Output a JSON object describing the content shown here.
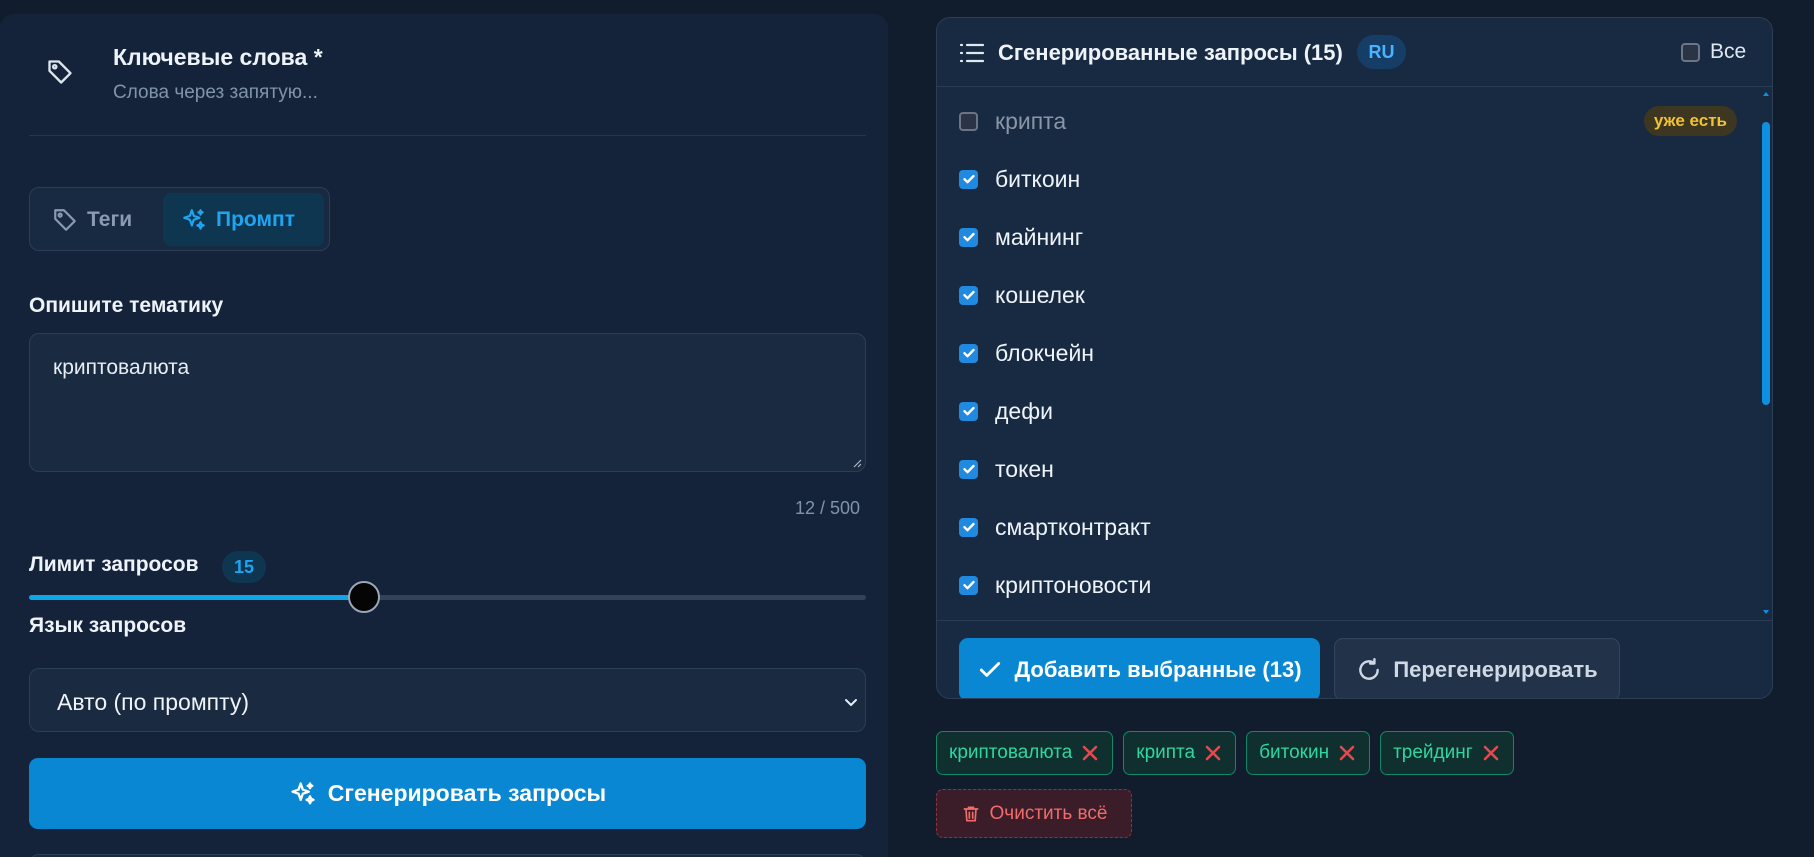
{
  "keywords": {
    "title": "Ключевые слова *",
    "subtitle": "Слова через запятую..."
  },
  "modes": {
    "tags_label": "Теги",
    "prompt_label": "Промпт",
    "active": "prompt"
  },
  "topic": {
    "label": "Опишите тематику",
    "value": "криптовалюта",
    "counter": "12 / 500"
  },
  "limit": {
    "label": "Лимит запросов",
    "value": 15,
    "value_text": "15",
    "level_fraction": 0.4
  },
  "language": {
    "label": "Язык запросов",
    "selected": "Авто (по промпту)"
  },
  "generate_button": "Сгенерировать запросы",
  "results": {
    "title": "Сгенерированные запросы (15)",
    "lang_badge": "RU",
    "select_all_label": "Все",
    "select_all_checked": false,
    "items": [
      {
        "label": "крипта",
        "checked": false,
        "badge": "уже есть"
      },
      {
        "label": "биткоин",
        "checked": true
      },
      {
        "label": "майнинг",
        "checked": true
      },
      {
        "label": "кошелек",
        "checked": true
      },
      {
        "label": "блокчейн",
        "checked": true
      },
      {
        "label": "дефи",
        "checked": true
      },
      {
        "label": "токен",
        "checked": true
      },
      {
        "label": "смартконтракт",
        "checked": true
      },
      {
        "label": "криптоновости",
        "checked": true
      }
    ],
    "add_button": "Добавить выбранные (13)",
    "regenerate_button": "Перегенерировать"
  },
  "chips": [
    "криптовалюта",
    "крипта",
    "битокин",
    "трейдинг"
  ],
  "clear_button": "Очистить всё",
  "colors": {
    "accent": "#0a87d2",
    "chip": "#2fd6a0",
    "danger": "#f26b6b",
    "warning": "#f2c230"
  },
  "icons": [
    "tag-icon",
    "sparkles-icon",
    "list-icon",
    "check-icon",
    "refresh-icon",
    "close-icon",
    "trash-icon",
    "chevron-down-icon"
  ]
}
